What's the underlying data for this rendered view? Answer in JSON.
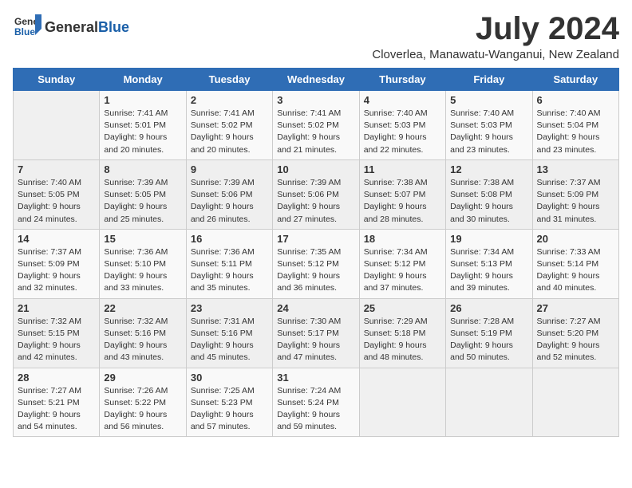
{
  "header": {
    "logo_general": "General",
    "logo_blue": "Blue",
    "month_title": "July 2024",
    "location": "Cloverlea, Manawatu-Wanganui, New Zealand"
  },
  "weekdays": [
    "Sunday",
    "Monday",
    "Tuesday",
    "Wednesday",
    "Thursday",
    "Friday",
    "Saturday"
  ],
  "weeks": [
    [
      {
        "day": "",
        "content": ""
      },
      {
        "day": "1",
        "content": "Sunrise: 7:41 AM\nSunset: 5:01 PM\nDaylight: 9 hours\nand 20 minutes."
      },
      {
        "day": "2",
        "content": "Sunrise: 7:41 AM\nSunset: 5:02 PM\nDaylight: 9 hours\nand 20 minutes."
      },
      {
        "day": "3",
        "content": "Sunrise: 7:41 AM\nSunset: 5:02 PM\nDaylight: 9 hours\nand 21 minutes."
      },
      {
        "day": "4",
        "content": "Sunrise: 7:40 AM\nSunset: 5:03 PM\nDaylight: 9 hours\nand 22 minutes."
      },
      {
        "day": "5",
        "content": "Sunrise: 7:40 AM\nSunset: 5:03 PM\nDaylight: 9 hours\nand 23 minutes."
      },
      {
        "day": "6",
        "content": "Sunrise: 7:40 AM\nSunset: 5:04 PM\nDaylight: 9 hours\nand 23 minutes."
      }
    ],
    [
      {
        "day": "7",
        "content": "Sunrise: 7:40 AM\nSunset: 5:05 PM\nDaylight: 9 hours\nand 24 minutes."
      },
      {
        "day": "8",
        "content": "Sunrise: 7:39 AM\nSunset: 5:05 PM\nDaylight: 9 hours\nand 25 minutes."
      },
      {
        "day": "9",
        "content": "Sunrise: 7:39 AM\nSunset: 5:06 PM\nDaylight: 9 hours\nand 26 minutes."
      },
      {
        "day": "10",
        "content": "Sunrise: 7:39 AM\nSunset: 5:06 PM\nDaylight: 9 hours\nand 27 minutes."
      },
      {
        "day": "11",
        "content": "Sunrise: 7:38 AM\nSunset: 5:07 PM\nDaylight: 9 hours\nand 28 minutes."
      },
      {
        "day": "12",
        "content": "Sunrise: 7:38 AM\nSunset: 5:08 PM\nDaylight: 9 hours\nand 30 minutes."
      },
      {
        "day": "13",
        "content": "Sunrise: 7:37 AM\nSunset: 5:09 PM\nDaylight: 9 hours\nand 31 minutes."
      }
    ],
    [
      {
        "day": "14",
        "content": "Sunrise: 7:37 AM\nSunset: 5:09 PM\nDaylight: 9 hours\nand 32 minutes."
      },
      {
        "day": "15",
        "content": "Sunrise: 7:36 AM\nSunset: 5:10 PM\nDaylight: 9 hours\nand 33 minutes."
      },
      {
        "day": "16",
        "content": "Sunrise: 7:36 AM\nSunset: 5:11 PM\nDaylight: 9 hours\nand 35 minutes."
      },
      {
        "day": "17",
        "content": "Sunrise: 7:35 AM\nSunset: 5:12 PM\nDaylight: 9 hours\nand 36 minutes."
      },
      {
        "day": "18",
        "content": "Sunrise: 7:34 AM\nSunset: 5:12 PM\nDaylight: 9 hours\nand 37 minutes."
      },
      {
        "day": "19",
        "content": "Sunrise: 7:34 AM\nSunset: 5:13 PM\nDaylight: 9 hours\nand 39 minutes."
      },
      {
        "day": "20",
        "content": "Sunrise: 7:33 AM\nSunset: 5:14 PM\nDaylight: 9 hours\nand 40 minutes."
      }
    ],
    [
      {
        "day": "21",
        "content": "Sunrise: 7:32 AM\nSunset: 5:15 PM\nDaylight: 9 hours\nand 42 minutes."
      },
      {
        "day": "22",
        "content": "Sunrise: 7:32 AM\nSunset: 5:16 PM\nDaylight: 9 hours\nand 43 minutes."
      },
      {
        "day": "23",
        "content": "Sunrise: 7:31 AM\nSunset: 5:16 PM\nDaylight: 9 hours\nand 45 minutes."
      },
      {
        "day": "24",
        "content": "Sunrise: 7:30 AM\nSunset: 5:17 PM\nDaylight: 9 hours\nand 47 minutes."
      },
      {
        "day": "25",
        "content": "Sunrise: 7:29 AM\nSunset: 5:18 PM\nDaylight: 9 hours\nand 48 minutes."
      },
      {
        "day": "26",
        "content": "Sunrise: 7:28 AM\nSunset: 5:19 PM\nDaylight: 9 hours\nand 50 minutes."
      },
      {
        "day": "27",
        "content": "Sunrise: 7:27 AM\nSunset: 5:20 PM\nDaylight: 9 hours\nand 52 minutes."
      }
    ],
    [
      {
        "day": "28",
        "content": "Sunrise: 7:27 AM\nSunset: 5:21 PM\nDaylight: 9 hours\nand 54 minutes."
      },
      {
        "day": "29",
        "content": "Sunrise: 7:26 AM\nSunset: 5:22 PM\nDaylight: 9 hours\nand 56 minutes."
      },
      {
        "day": "30",
        "content": "Sunrise: 7:25 AM\nSunset: 5:23 PM\nDaylight: 9 hours\nand 57 minutes."
      },
      {
        "day": "31",
        "content": "Sunrise: 7:24 AM\nSunset: 5:24 PM\nDaylight: 9 hours\nand 59 minutes."
      },
      {
        "day": "",
        "content": ""
      },
      {
        "day": "",
        "content": ""
      },
      {
        "day": "",
        "content": ""
      }
    ]
  ]
}
